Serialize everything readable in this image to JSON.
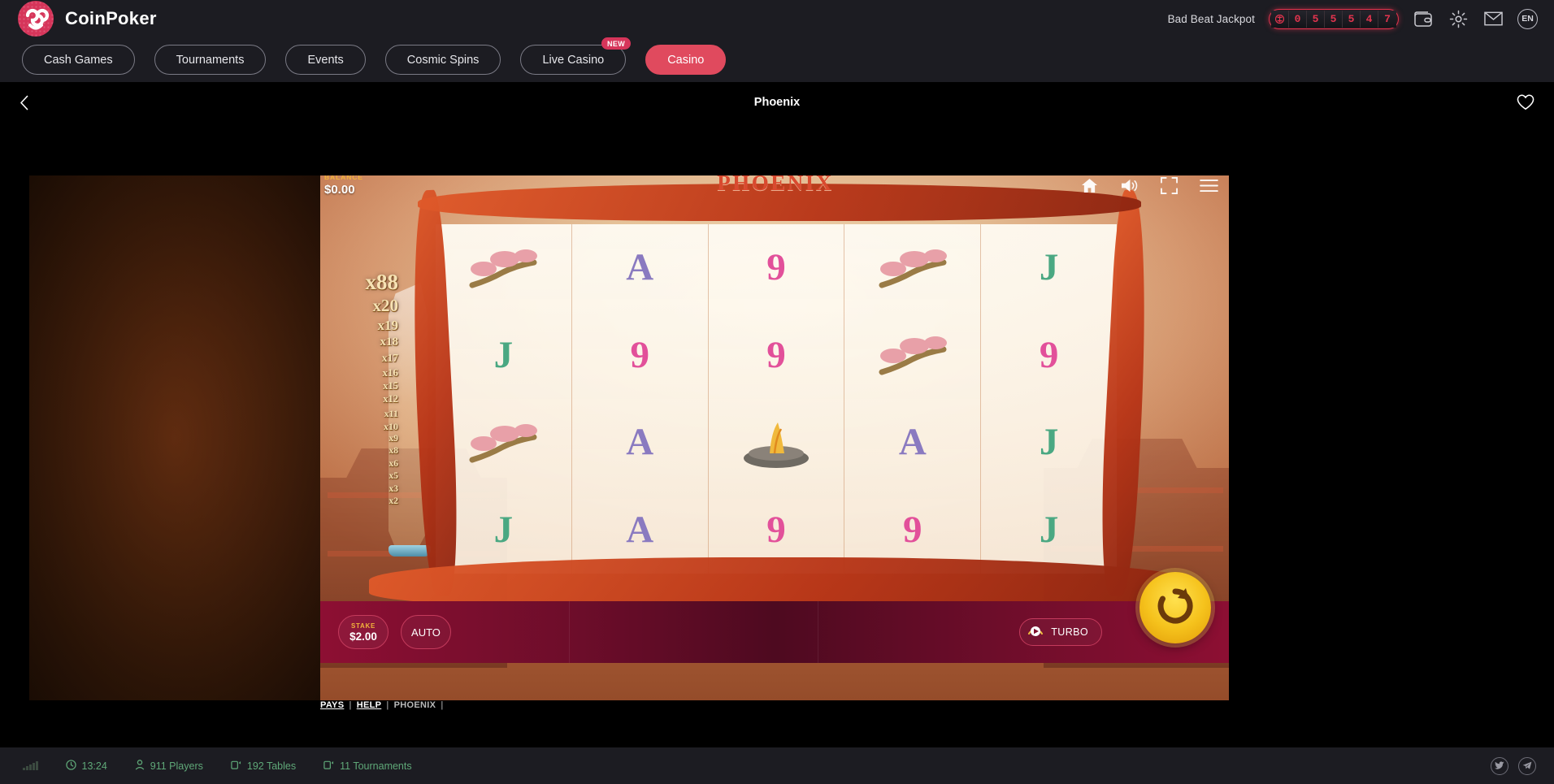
{
  "header": {
    "brand_name": "CoinPoker",
    "logo_icon": "coinpoker-infinity-logo",
    "jackpot_label": "Bad Beat Jackpot",
    "jackpot_chip_icon": "poker-chip-icon",
    "jackpot_digits": [
      "0",
      "5",
      "5",
      "5",
      "4",
      "7"
    ],
    "jackpot_color": "#e2344e",
    "wallet_icon": "wallet-icon",
    "settings_icon": "gear-icon",
    "mail_icon": "envelope-icon",
    "language": "EN"
  },
  "nav": {
    "items": [
      {
        "label": "Cash Games",
        "active": false,
        "badge": ""
      },
      {
        "label": "Tournaments",
        "active": false,
        "badge": ""
      },
      {
        "label": "Events",
        "active": false,
        "badge": ""
      },
      {
        "label": "Cosmic Spins",
        "active": false,
        "badge": ""
      },
      {
        "label": "Live Casino",
        "active": false,
        "badge": "NEW"
      },
      {
        "label": "Casino",
        "active": true,
        "badge": ""
      }
    ],
    "active_color": "#e04a5e",
    "badge_color": "#d6355a"
  },
  "subheader": {
    "back_icon": "chevron-left-icon",
    "title": "Phoenix",
    "favorite_icon": "heart-icon"
  },
  "game": {
    "title": "PHOENIX",
    "title_color": "#d94a2f",
    "balance_label": "BALANCE",
    "balance_value": "$0.00",
    "balance_label_color": "#f1b33b",
    "tools": [
      {
        "icon": "home-icon",
        "name": "home"
      },
      {
        "icon": "speaker-icon",
        "name": "sound"
      },
      {
        "icon": "fullscreen-icon",
        "name": "fullscreen"
      },
      {
        "icon": "menu-icon",
        "name": "menu"
      }
    ],
    "multiplier_ladder": [
      "x88",
      "x20",
      "x19",
      "x18",
      "x17",
      "x16",
      "x15",
      "x12",
      "x11",
      "x10",
      "x9",
      "x8",
      "x6",
      "x5",
      "x3",
      "x2"
    ],
    "reels": [
      [
        "cherry-tree",
        "J",
        "cherry-tree",
        "J"
      ],
      [
        "A",
        "9",
        "A",
        "A"
      ],
      [
        "9",
        "9",
        "phoenix-nest",
        "9"
      ],
      [
        "cherry-tree",
        "cherry-tree",
        "A",
        "9"
      ],
      [
        "J",
        "9",
        "J",
        "J"
      ]
    ],
    "controls": {
      "stake_label": "STAKE",
      "stake_value": "$2.00",
      "auto_label": "AUTO",
      "turbo_label": "TURBO",
      "turbo_icon": "turbo-gauge-icon",
      "spin_icon": "spin-refresh-icon"
    },
    "links": {
      "pays": "PAYS",
      "help": "HELP",
      "name": "PHOENIX",
      "divider": "|"
    }
  },
  "statusbar": {
    "signal_icon": "signal-bars-icon",
    "items": [
      {
        "icon": "clock-icon",
        "label": "13:24"
      },
      {
        "icon": "person-icon",
        "label": "911 Players"
      },
      {
        "icon": "table-icon",
        "label": "192 Tables"
      },
      {
        "icon": "tournament-icon",
        "label": "11 Tournaments"
      }
    ],
    "text_color": "#5fa878",
    "social": [
      {
        "icon": "twitter-icon",
        "name": "twitter"
      },
      {
        "icon": "telegram-icon",
        "name": "telegram"
      }
    ]
  }
}
